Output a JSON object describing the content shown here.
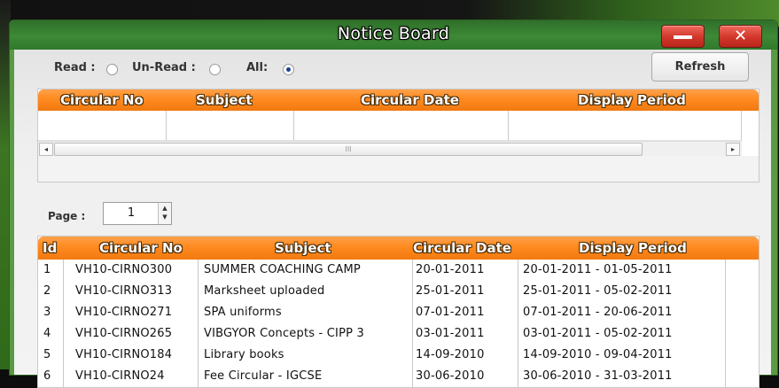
{
  "window": {
    "title": "Notice Board",
    "minimize_icon": "minimize-icon",
    "close_icon": "close-icon",
    "close_glyph": "✕"
  },
  "filters": {
    "read_label": "Read :",
    "unread_label": "Un-Read :",
    "all_label": "All:",
    "selected": "All"
  },
  "refresh_label": "Refresh",
  "top_grid": {
    "columns": [
      "Circular No",
      "Subject",
      "Circular Date",
      "Display Period"
    ],
    "scroll_left": "◂",
    "scroll_right": "▸",
    "thumb_grip": "III"
  },
  "pager": {
    "label": "Page :",
    "value": "1",
    "up": "▲",
    "down": "▼"
  },
  "list": {
    "columns": [
      "Id",
      "Circular No",
      "Subject",
      "Circular Date",
      "Display Period"
    ],
    "rows": [
      {
        "id": "1",
        "no": "VH10-CIRNO300",
        "subject": "SUMMER COACHING CAMP",
        "date": "20-01-2011",
        "period": "20-01-2011 - 01-05-2011"
      },
      {
        "id": "2",
        "no": "VH10-CIRNO313",
        "subject": "Marksheet uploaded",
        "date": "25-01-2011",
        "period": "25-01-2011 - 05-02-2011"
      },
      {
        "id": "3",
        "no": "VH10-CIRNO271",
        "subject": "SPA uniforms",
        "date": "07-01-2011",
        "period": "07-01-2011 - 20-06-2011"
      },
      {
        "id": "4",
        "no": "VH10-CIRNO265",
        "subject": "VIBGYOR Concepts - CIPP 3",
        "date": "03-01-2011",
        "period": "03-01-2011 - 05-02-2011"
      },
      {
        "id": "5",
        "no": "VH10-CIRNO184",
        "subject": "Library books",
        "date": "14-09-2010",
        "period": "14-09-2010 - 09-04-2011"
      },
      {
        "id": "6",
        "no": "VH10-CIRNO24",
        "subject": "Fee Circular - IGCSE",
        "date": "30-06-2010",
        "period": "30-06-2010 - 31-03-2011"
      }
    ]
  }
}
